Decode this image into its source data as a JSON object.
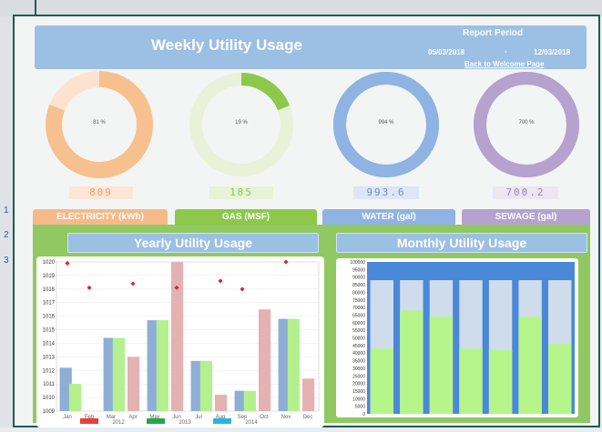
{
  "background": {
    "row_numbers": [
      "1",
      "2",
      "3"
    ]
  },
  "header": {
    "title": "Weekly Utility Usage",
    "report_period_label": "Report Period",
    "start_date": "05/03/2018",
    "separator": "-",
    "end_date": "12/03/2018",
    "back_link": "Back to Welcome Page"
  },
  "gauges": [
    {
      "name": "electricity",
      "percent_label": "81 %",
      "percent": 81,
      "counter": "809",
      "color": "#f6c08f",
      "track": "#fde3cf",
      "counter_color": "#f0a070",
      "counter_bg": "#fde6d6"
    },
    {
      "name": "gas",
      "percent_label": "19 %",
      "percent": 19,
      "counter": "185",
      "color": "#8dc84b",
      "track": "#e9f1d9",
      "counter_color": "#8dc84b",
      "counter_bg": "#e7f2d7"
    },
    {
      "name": "water",
      "percent_label": "994 %",
      "percent": 100,
      "counter": "993.6",
      "color": "#8fb3e3",
      "track": "#8fb3e3",
      "counter_color": "#6a8fd0",
      "counter_bg": "#dde6f5"
    },
    {
      "name": "sewage",
      "percent_label": "700 %",
      "percent": 100,
      "counter": "700.2",
      "color": "#b5a2ce",
      "track": "#b5a2ce",
      "counter_color": "#9b87bf",
      "counter_bg": "#ece6f3"
    }
  ],
  "tabs": [
    {
      "label": "ELECTRICITY (kWh)",
      "color": "#f6b98a"
    },
    {
      "label": "GAS (MSF)",
      "color": "#8dc84b"
    },
    {
      "label": "WATER (gal)",
      "color": "#8fb3e3"
    },
    {
      "label": "SEWAGE (gal)",
      "color": "#b5a2ce"
    }
  ],
  "yearly_title": "Yearly Utility Usage",
  "monthly_title": "Monthly Utility Usage",
  "chart_data": [
    {
      "type": "bar",
      "title": "Yearly Utility Usage",
      "categories": [
        "Jan",
        "Feb",
        "Mar",
        "Apr",
        "May",
        "Jun",
        "Jul",
        "Aug",
        "Sep",
        "Oct",
        "Nov",
        "Dec"
      ],
      "ylim": [
        1009,
        1020
      ],
      "yticks": [
        "1020",
        "1019",
        "1018",
        "1017",
        "1016",
        "1015",
        "1014",
        "1013",
        "1012",
        "1011",
        "1010",
        "1009"
      ],
      "series": [
        {
          "name": "2012",
          "color": "#8eaed6",
          "values": [
            1012.2,
            null,
            1014.4,
            null,
            1015.7,
            null,
            1012.7,
            null,
            1010.5,
            null,
            1015.8,
            null
          ]
        },
        {
          "name": "2013",
          "color": "#b4f08e",
          "values": [
            1011.0,
            null,
            1014.4,
            null,
            1015.7,
            null,
            1012.7,
            null,
            1010.5,
            null,
            1015.8,
            null
          ]
        },
        {
          "name": "2014",
          "color": "#e4b2b2",
          "values": [
            null,
            null,
            null,
            1013.0,
            null,
            1020.0,
            null,
            1010.2,
            null,
            1016.5,
            null,
            1011.4
          ]
        }
      ],
      "markers": {
        "color": "#e02020",
        "values": [
          1019.9,
          1018.1,
          null,
          1018.4,
          null,
          1018.1,
          null,
          1018.6,
          1018.0,
          null,
          1020.0,
          null
        ]
      },
      "legend": [
        {
          "label": "2012",
          "color": "#ee3b3b"
        },
        {
          "label": "2013",
          "color": "#1eaa4c"
        },
        {
          "label": "2014",
          "color": "#25b4e6"
        }
      ]
    },
    {
      "type": "bar",
      "title": "Monthly Utility Usage",
      "ylim": [
        0,
        100000
      ],
      "yticks": [
        "100000",
        "95000",
        "90000",
        "85000",
        "80000",
        "75000",
        "70000",
        "65000",
        "60000",
        "55000",
        "50000",
        "45000",
        "40000",
        "35000",
        "30000",
        "25000",
        "20000",
        "15000",
        "10000",
        "5000",
        "0"
      ],
      "bar_max": 88000,
      "values": [
        43000,
        68000,
        64000,
        43000,
        42000,
        64000,
        46000
      ],
      "colors": {
        "top": "#4a88d8",
        "track": "#cfdcec",
        "fill": "#b6f58a"
      }
    }
  ]
}
